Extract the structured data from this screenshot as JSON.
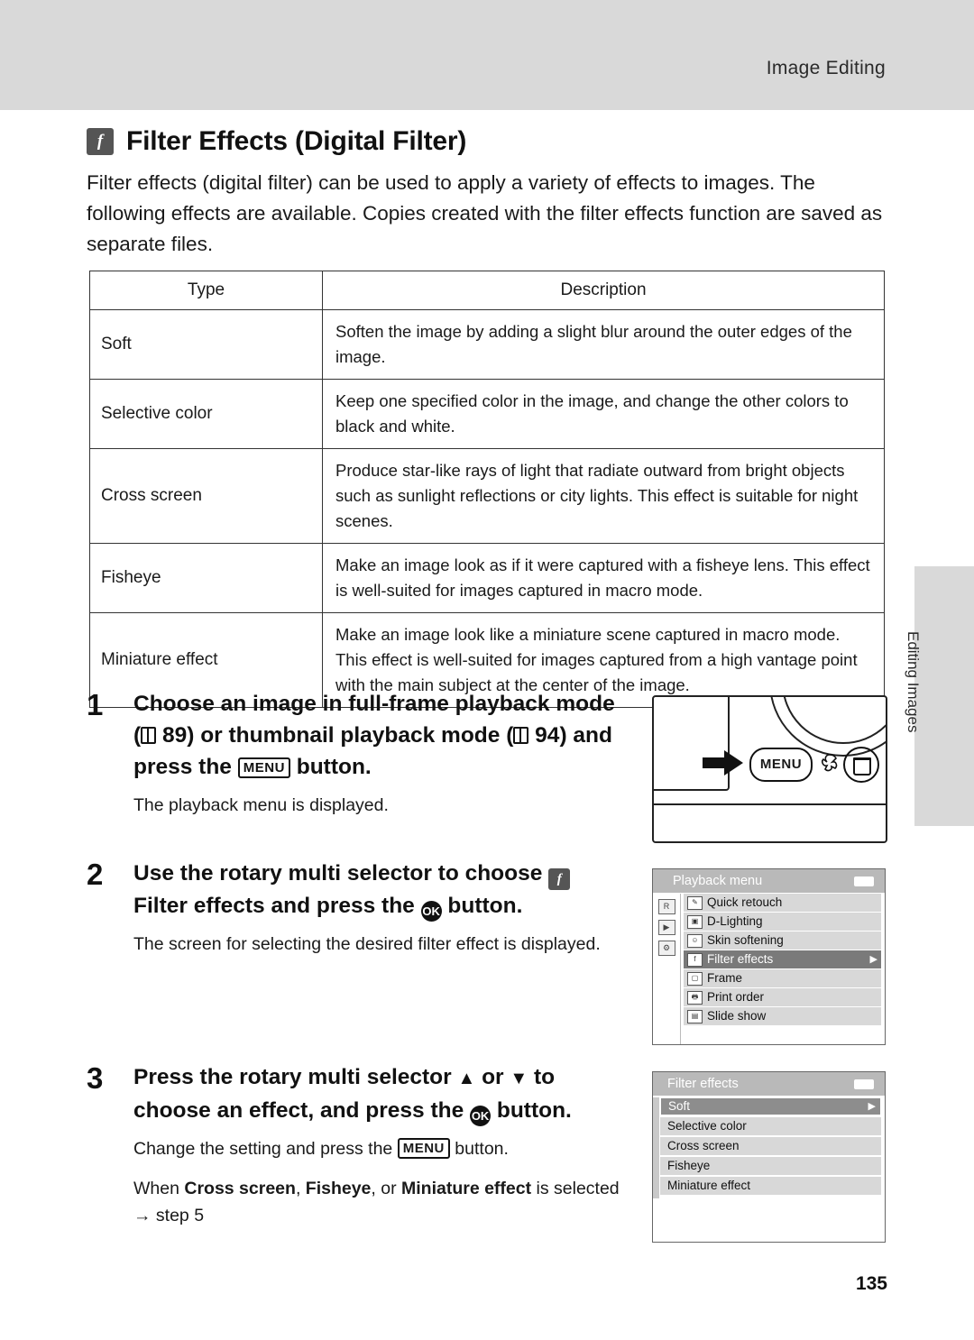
{
  "header": {
    "running_title": "Image Editing"
  },
  "side_tab": {
    "label": "Editing Images"
  },
  "heading": {
    "badge": "f",
    "title": "Filter Effects (Digital Filter)"
  },
  "intro": "Filter effects (digital filter) can be used to apply a variety of effects to images. The following effects are available. Copies created with the filter effects function are saved as separate files.",
  "table": {
    "headers": [
      "Type",
      "Description"
    ],
    "rows": [
      {
        "type": "Soft",
        "description": "Soften the image by adding a slight blur around the outer edges of the image."
      },
      {
        "type": "Selective color",
        "description": "Keep one specified color in the image, and change the other colors to black and white."
      },
      {
        "type": "Cross screen",
        "description": "Produce star-like rays of light that radiate outward from bright objects such as sunlight reflections or city lights. This effect is suitable for night scenes."
      },
      {
        "type": "Fisheye",
        "description": "Make an image look as if it were captured with a fisheye lens. This effect is well-suited for images captured in macro mode."
      },
      {
        "type": "Miniature effect",
        "description": "Make an image look like a miniature scene captured in macro mode. This effect is well-suited for images captured from a high vantage point with the main subject at the center of the image."
      }
    ]
  },
  "steps": [
    {
      "number": "1",
      "title_part1": "Choose an image in full-frame playback mode (",
      "ref1": "89",
      "title_part2": ") or thumbnail playback mode (",
      "ref2": "94",
      "title_part3": ") and press the ",
      "menu_key": "MENU",
      "title_part4": " button.",
      "body": "The playback menu is displayed."
    },
    {
      "number": "2",
      "title_part1": "Use the rotary multi selector to choose ",
      "filter_icon": "f",
      "title_bold": "Filter effects",
      "title_part2": " and press the ",
      "ok_key": "OK",
      "title_part3": " button.",
      "body": "The screen for selecting the desired filter effect is displayed."
    },
    {
      "number": "3",
      "title_part1": "Press the rotary multi selector ",
      "up": "▲",
      "title_or": " or ",
      "down": "▼",
      "title_part2": " to choose an effect, and press the ",
      "ok_key": "OK",
      "title_part3": " button.",
      "body1_part1": "Change the setting and press the ",
      "body1_menu": "MENU",
      "body1_part2": " button.",
      "body2_prefix": "When ",
      "body2_b1": "Cross screen",
      "body2_sep1": ", ",
      "body2_b2": "Fisheye",
      "body2_sep2": ", or ",
      "body2_b3": "Miniature effect",
      "body2_suffix": " is selected ",
      "body2_arrow": "→",
      "body2_end": " step 5"
    }
  ],
  "camera_figure": {
    "menu_button_label": "MENU",
    "macro_icon": "macro-flower-icon",
    "trash_icon": "trash-icon",
    "arrow_icon": "right-arrow-icon"
  },
  "lcd_playback_menu": {
    "title": "Playback menu",
    "battery_icon": "battery-icon",
    "left_icons": [
      "REC",
      "playback-icon",
      "wrench-icon"
    ],
    "items": [
      {
        "icon": "retouch-icon",
        "label": "Quick retouch",
        "selected": false,
        "arrow": ""
      },
      {
        "icon": "d-lighting-icon",
        "label": "D-Lighting",
        "selected": false,
        "arrow": ""
      },
      {
        "icon": "skin-icon",
        "label": "Skin softening",
        "selected": false,
        "arrow": ""
      },
      {
        "icon": "filter-icon",
        "label": "Filter effects",
        "selected": true,
        "arrow": "▶"
      },
      {
        "icon": "frame-icon",
        "label": "Frame",
        "selected": false,
        "arrow": ""
      },
      {
        "icon": "print-icon",
        "label": "Print order",
        "selected": false,
        "arrow": ""
      },
      {
        "icon": "slideshow-icon",
        "label": "Slide show",
        "selected": false,
        "arrow": ""
      }
    ]
  },
  "lcd_filter_effects": {
    "title": "Filter effects",
    "battery_icon": "battery-icon",
    "items": [
      {
        "label": "Soft",
        "selected": true,
        "arrow": "▶"
      },
      {
        "label": "Selective color",
        "selected": false,
        "arrow": ""
      },
      {
        "label": "Cross screen",
        "selected": false,
        "arrow": ""
      },
      {
        "label": "Fisheye",
        "selected": false,
        "arrow": ""
      },
      {
        "label": "Miniature effect",
        "selected": false,
        "arrow": ""
      }
    ]
  },
  "page_number": "135"
}
